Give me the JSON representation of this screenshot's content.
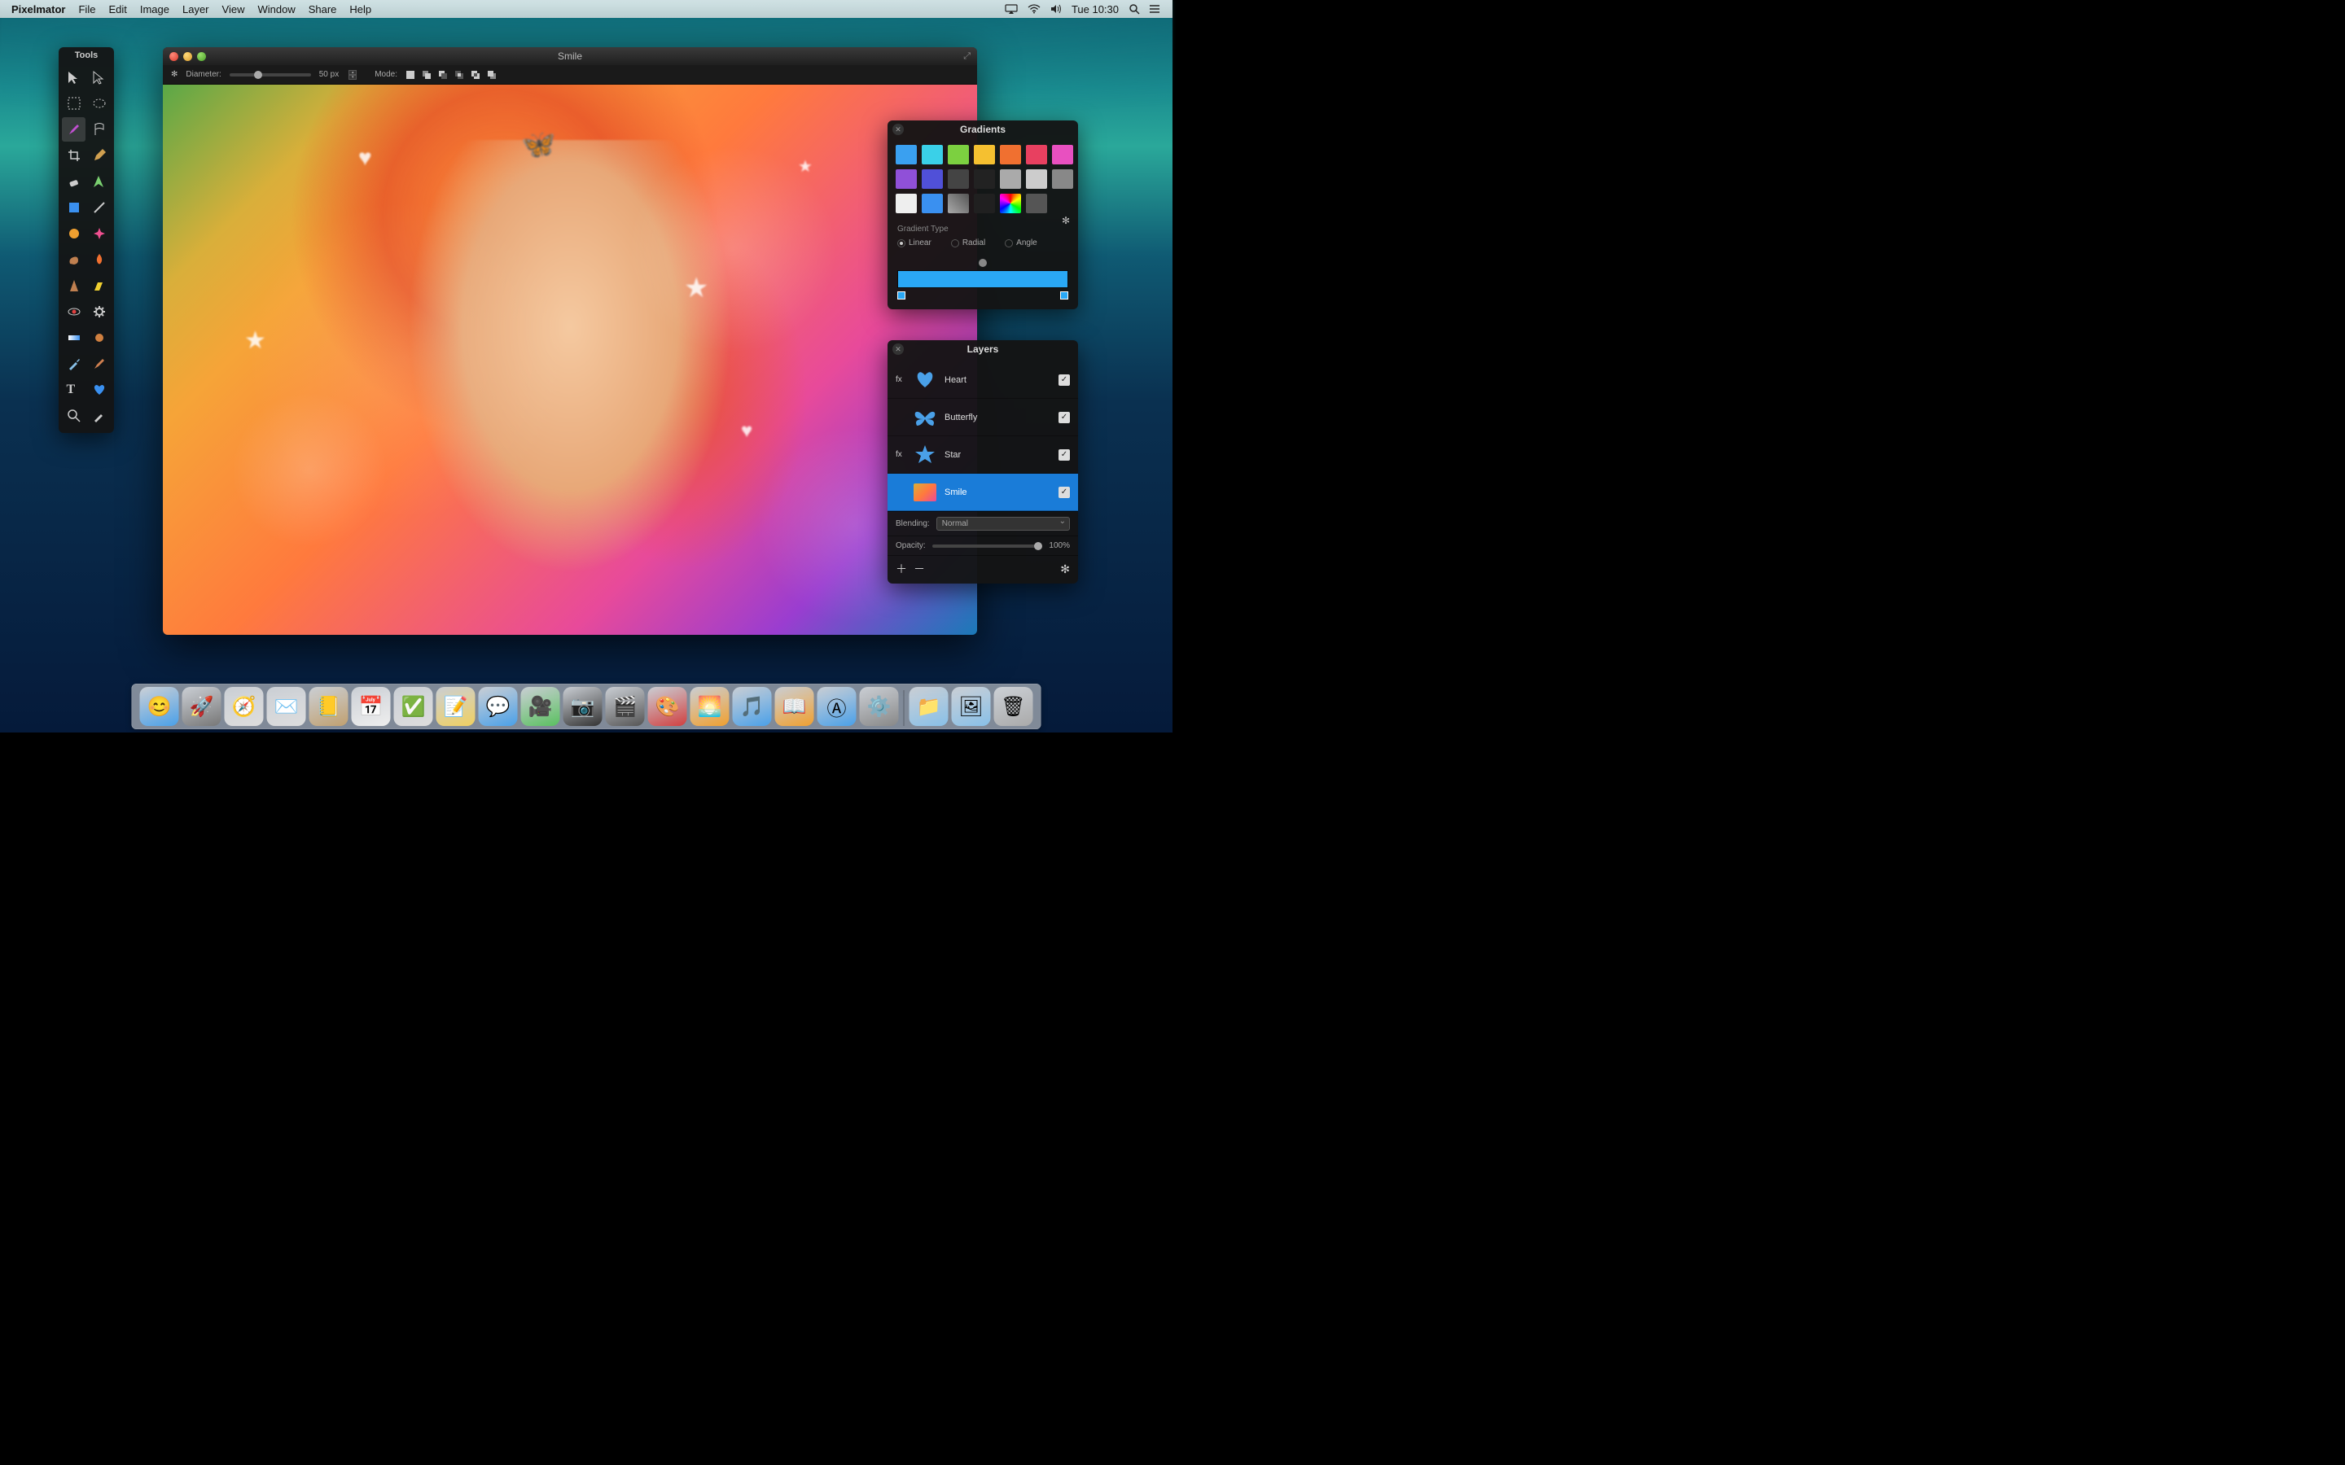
{
  "menubar": {
    "app_name": "Pixelmator",
    "items": [
      "File",
      "Edit",
      "Image",
      "Layer",
      "View",
      "Window",
      "Share",
      "Help"
    ],
    "clock": "Tue 10:30"
  },
  "tools_palette": {
    "title": "Tools",
    "tools": [
      "move-tool",
      "arrow-tool",
      "marquee-tool",
      "ellipse-marquee-tool",
      "brush-tool",
      "flag-tool",
      "crop-tool",
      "pencil-tool",
      "eraser-tool",
      "pen-tool",
      "shape-tool",
      "line-tool",
      "sphere-tool",
      "sparkle-tool",
      "smudge-tool",
      "flame-tool",
      "sharpen-tool",
      "highlight-tool",
      "red-eye-tool",
      "cog-tool",
      "gradient-tool",
      "spot-tool",
      "eyedropper-tool",
      "brush2-tool",
      "type-tool",
      "heart-tool",
      "zoom-tool",
      "color-picker-tool"
    ]
  },
  "document": {
    "title": "Smile",
    "toolbar": {
      "diameter_label": "Diameter:",
      "diameter_value": "50 px",
      "mode_label": "Mode:"
    }
  },
  "gradients_panel": {
    "title": "Gradients",
    "type_label": "Gradient Type",
    "types": {
      "linear": "Linear",
      "radial": "Radial",
      "angle": "Angle"
    },
    "selected_type": "linear",
    "swatches": [
      "#3aa0f0",
      "#3ad0e8",
      "#7cd040",
      "#f5c030",
      "#f07030",
      "#e84060",
      "#e850c0",
      "#9050d8",
      "#5050d8",
      "#444444",
      "#222222",
      "#aaaaaa",
      "#cccccc",
      "#888888",
      "#eeeeee",
      "#3a90f0",
      "linear-gradient(45deg,#aaa,#555)",
      "#202020",
      "conic-gradient(red,yellow,lime,cyan,blue,magenta,red)",
      "#555555"
    ]
  },
  "layers_panel": {
    "title": "Layers",
    "layers": [
      {
        "fx": "fx",
        "icon": "heart",
        "name": "Heart",
        "visible": true,
        "selected": false
      },
      {
        "fx": "",
        "icon": "butterfly",
        "name": "Butterfly",
        "visible": true,
        "selected": false
      },
      {
        "fx": "fx",
        "icon": "star",
        "name": "Star",
        "visible": true,
        "selected": false
      },
      {
        "fx": "",
        "icon": "thumb",
        "name": "Smile",
        "visible": true,
        "selected": true
      }
    ],
    "blending_label": "Blending:",
    "blending_value": "Normal",
    "opacity_label": "Opacity:",
    "opacity_value": "100%"
  },
  "dock": {
    "items": [
      "finder",
      "launchpad",
      "safari",
      "mail",
      "contacts",
      "calendar",
      "reminders",
      "notes",
      "messages",
      "facetime",
      "photo-booth",
      "camera",
      "pixelmator",
      "iphoto",
      "itunes",
      "ibooks",
      "app-store",
      "settings"
    ],
    "right_items": [
      "documents",
      "downloads",
      "trash"
    ]
  }
}
